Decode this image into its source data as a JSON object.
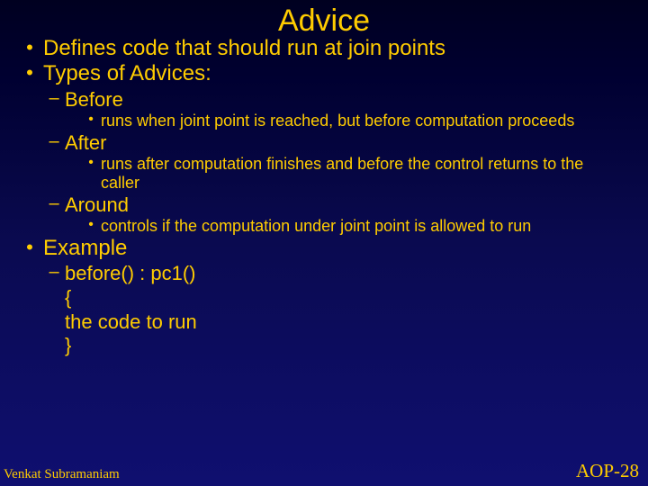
{
  "title": "Advice",
  "b1": "Defines code that should run at join points",
  "b2": "Types of Advices:",
  "s1": "Before",
  "s1d": "runs when joint point is reached, but before computation proceeds",
  "s2": "After",
  "s2d": "runs after computation finishes and before the control returns to the caller",
  "s3": "Around",
  "s3d": "controls if the computation under joint point is allowed to run",
  "b3": "Example",
  "c1": "before() : pc1()",
  "c2": "{",
  "c3": "the code to run",
  "c4": "}",
  "footer_left": "Venkat Subramaniam",
  "footer_right": "AOP-28"
}
